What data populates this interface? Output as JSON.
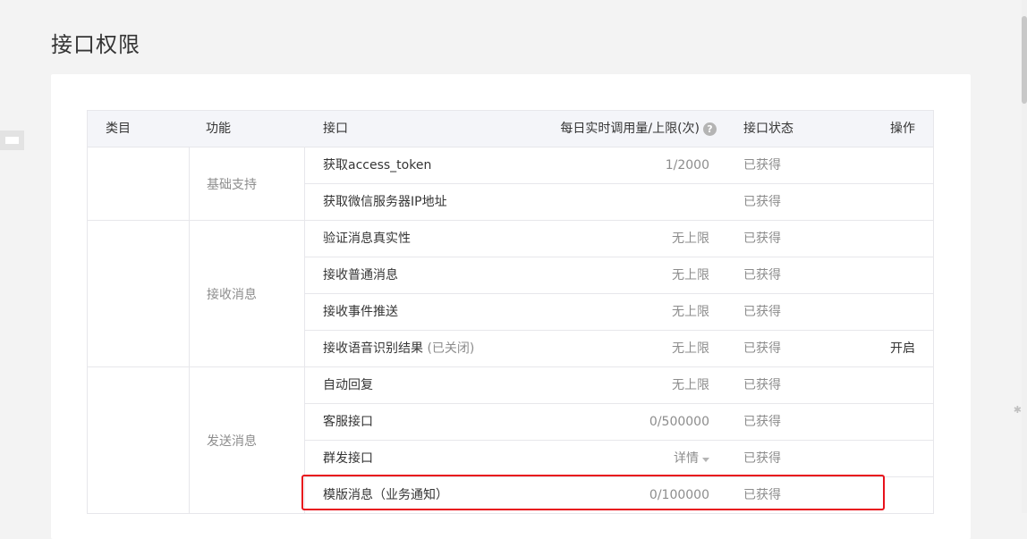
{
  "page": {
    "title": "接口权限"
  },
  "table": {
    "headers": {
      "category": "类目",
      "function": "功能",
      "interface": "接口",
      "quota": "每日实时调用量/上限(次)",
      "status": "接口状态",
      "operation": "操作"
    },
    "help_icon": "question-icon",
    "groups": [
      {
        "label": "基础支持",
        "rows": [
          {
            "name": "获取access_token",
            "note": "",
            "quota": "1/2000",
            "status": "已获得",
            "op": ""
          },
          {
            "name": "获取微信服务器IP地址",
            "note": "",
            "quota": "",
            "status": "已获得",
            "op": ""
          }
        ]
      },
      {
        "label": "接收消息",
        "rows": [
          {
            "name": "验证消息真实性",
            "note": "",
            "quota": "无上限",
            "status": "已获得",
            "op": ""
          },
          {
            "name": "接收普通消息",
            "note": "",
            "quota": "无上限",
            "status": "已获得",
            "op": ""
          },
          {
            "name": "接收事件推送",
            "note": "",
            "quota": "无上限",
            "status": "已获得",
            "op": ""
          },
          {
            "name": "接收语音识别结果",
            "note": "(已关闭)",
            "quota": "无上限",
            "status": "已获得",
            "op": "开启"
          }
        ]
      },
      {
        "label": "发送消息",
        "rows": [
          {
            "name": "自动回复",
            "note": "",
            "quota": "无上限",
            "status": "已获得",
            "op": ""
          },
          {
            "name": "客服接口",
            "note": "",
            "quota": "0/500000",
            "status": "已获得",
            "op": ""
          },
          {
            "name": "群发接口",
            "note": "",
            "quota": "详情",
            "status": "已获得",
            "op": ""
          },
          {
            "name": "模版消息（业务通知）",
            "note": "",
            "quota": "0/100000",
            "status": "已获得",
            "op": ""
          }
        ]
      }
    ]
  },
  "colors": {
    "highlight": "#e8121c",
    "header_bg": "#f4f5f9",
    "muted": "#8d8d8d"
  }
}
